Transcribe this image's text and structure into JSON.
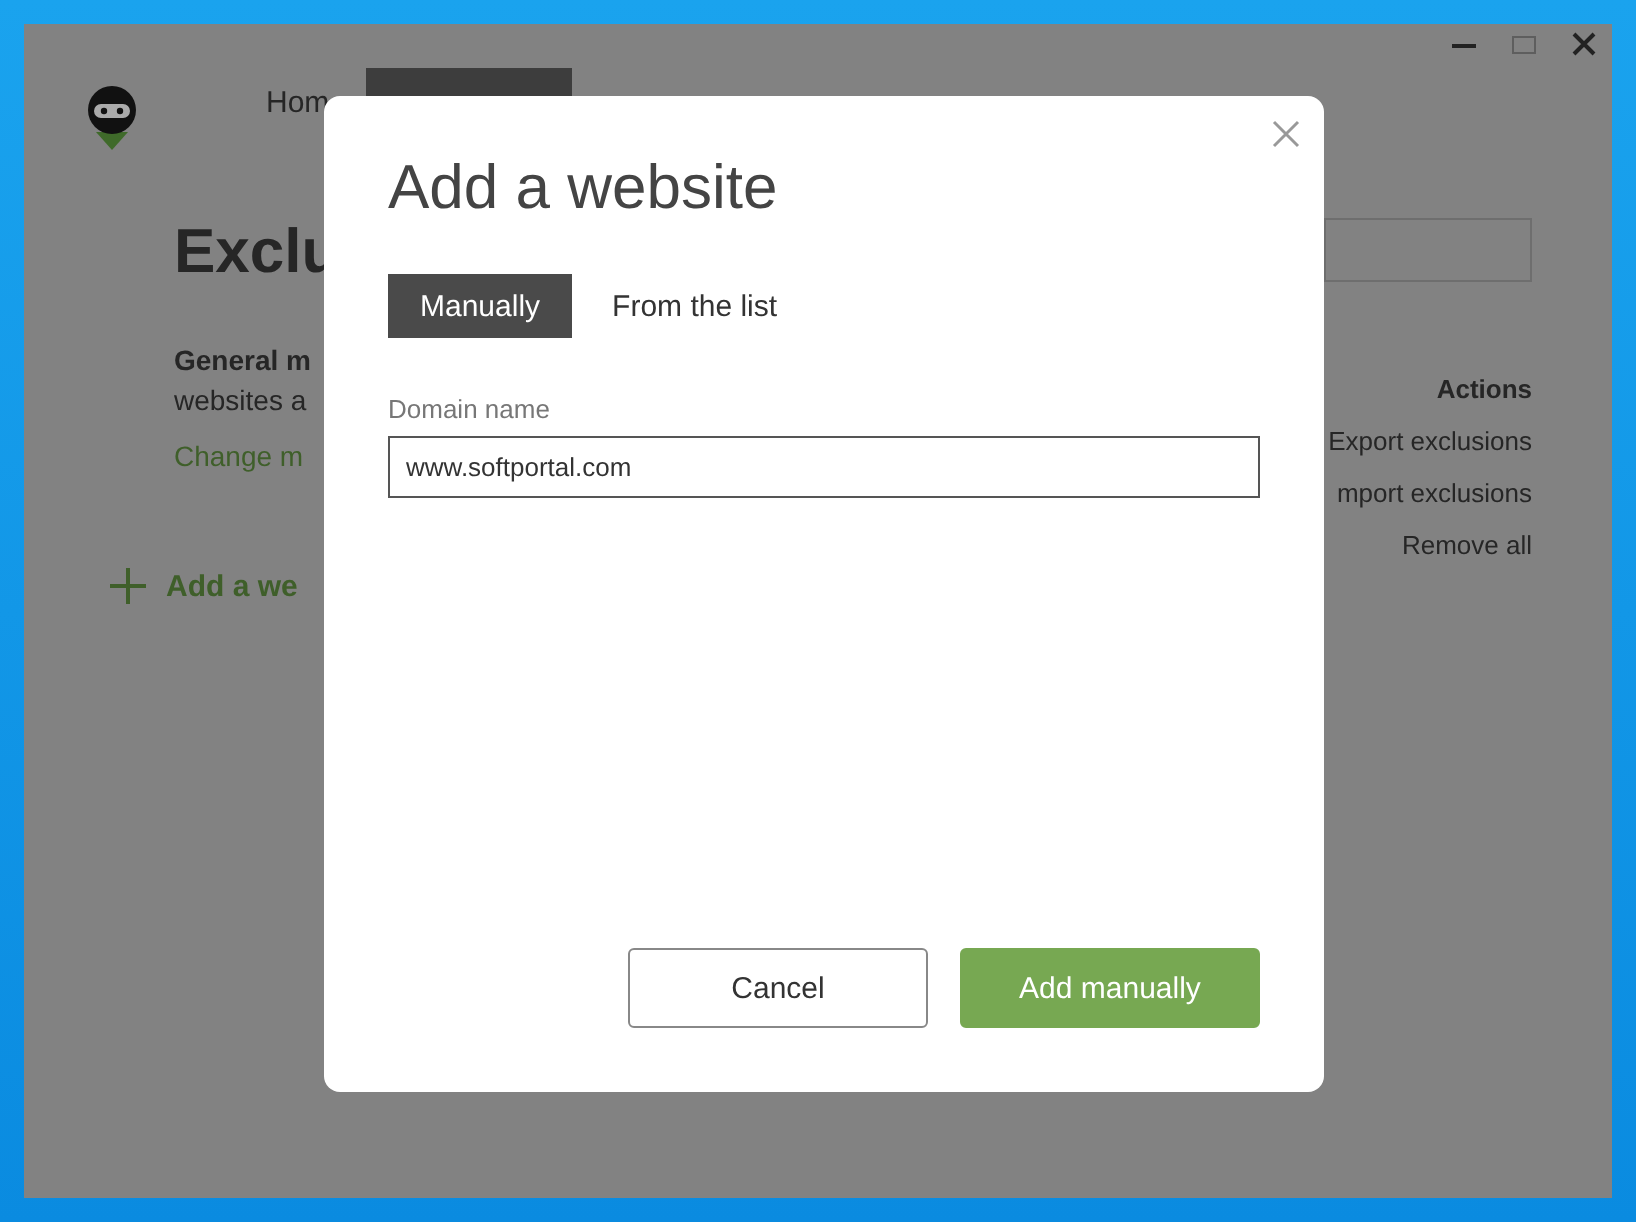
{
  "window": {
    "nav": [
      {
        "label": "Hom",
        "selected": false
      },
      {
        "selected": true
      }
    ],
    "heading": "Exclu",
    "general_title": "General m",
    "general_text": "websites a",
    "change_link": "Change m",
    "add_link": "Add a we",
    "actions": {
      "title": "Actions",
      "items": [
        "Export exclusions",
        "mport exclusions",
        "Remove all"
      ]
    }
  },
  "dialog": {
    "title": "Add a website",
    "tabs": [
      {
        "label": "Manually",
        "selected": true
      },
      {
        "label": "From the list",
        "selected": false
      }
    ],
    "field": {
      "label": "Domain name",
      "value": "www.softportal.com"
    },
    "buttons": [
      {
        "label": "Cancel",
        "kind": "secondary"
      },
      {
        "label": "Add manually",
        "kind": "primary"
      }
    ]
  }
}
